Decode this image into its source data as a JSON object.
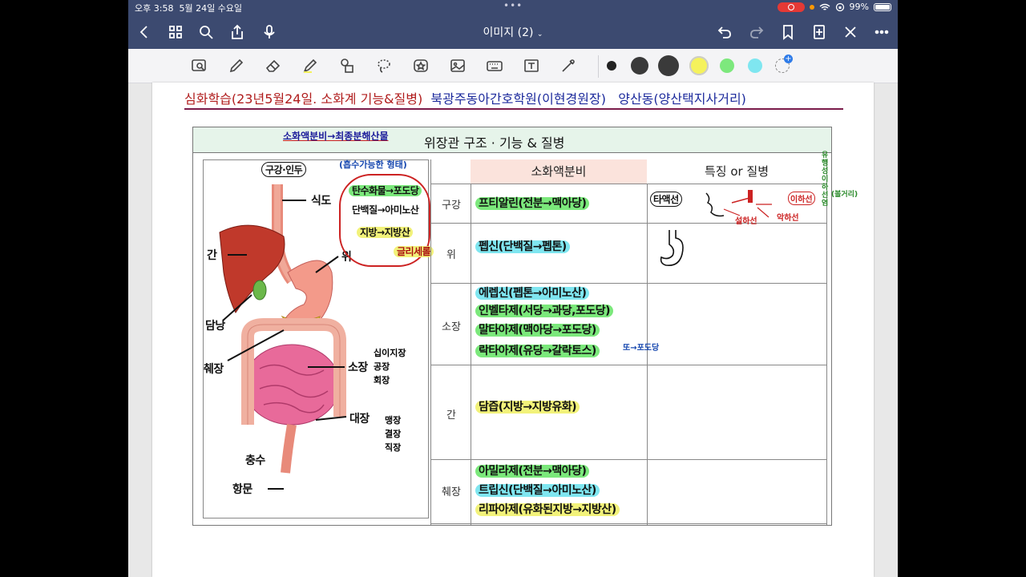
{
  "status_bar": {
    "time": "오후 3:58",
    "date": "5월 24일 수요일",
    "battery": "99%"
  },
  "nav": {
    "doc_title": "이미지 (2)"
  },
  "toolbar": {
    "colors": [
      "#222222",
      "#3a3a3a",
      "#3a3a3a",
      "#f5f25c",
      "#7de87d",
      "#7fe6f0"
    ],
    "add_color": "+"
  },
  "page": {
    "header": {
      "part1": "심화학습(23년5월24일. 소화계 기능&질병)",
      "part2": "북광주동아간호학원(이현경원장)",
      "part3": "양산동(양산택지사거리)"
    },
    "table_title": "위장관 구조 · 기능 & 질병",
    "col_headers": {
      "secretion": "소화액분비",
      "features": "특징 or 질병"
    },
    "organs": [
      "구강",
      "위",
      "소장",
      "간",
      "췌장"
    ],
    "rows": {
      "mouth": [
        "프티알린(전분→맥아당)"
      ],
      "stomach": [
        "펩신(단백질→펩톤)"
      ],
      "small_intestine": [
        "에렙신(펩톤→아미노산)",
        "인벨타제(서당→과당,포도당)",
        "말타아제(맥아당→포도당)",
        "락타아제(유당→갈락토스)"
      ],
      "liver": [
        "담즙(지방→지방유화)"
      ],
      "pancreas": [
        "아밀라제(전분→맥아당)",
        "트립신(단백질→아미노산)",
        "리파아제(유화된지방→지방산)"
      ]
    },
    "annotations": {
      "top_left": "소화액분비→최종분해산물",
      "top_paren": "(흡수가능한 형태)",
      "carb": "탄수화물→포도당",
      "protein": "단백질→아미노산",
      "fat": "지방→지방산",
      "glycerol": "글리세롤",
      "small_int_note": "또→포도당",
      "mouth_side": "구강·인두",
      "esophagus": "식도",
      "liver_label": "간",
      "stomach_label": "위",
      "gallbladder": "담낭",
      "pancreas_label": "췌장",
      "small_int_label": "소장",
      "duodenum": "십이지장",
      "jejunum": "공장",
      "ileum": "회장",
      "large_int_label": "대장",
      "cecum": "맹장",
      "colon": "결장",
      "rectum": "직장",
      "appendix": "충수",
      "anus": "항문",
      "feature_salivary": "타액선",
      "feature_parotid": "이하선",
      "feature_sublingual": "설하선",
      "feature_submandibular": "악하선",
      "feature_mumps": "유행성이하선염",
      "feature_mumps2": "(볼거리)"
    }
  }
}
